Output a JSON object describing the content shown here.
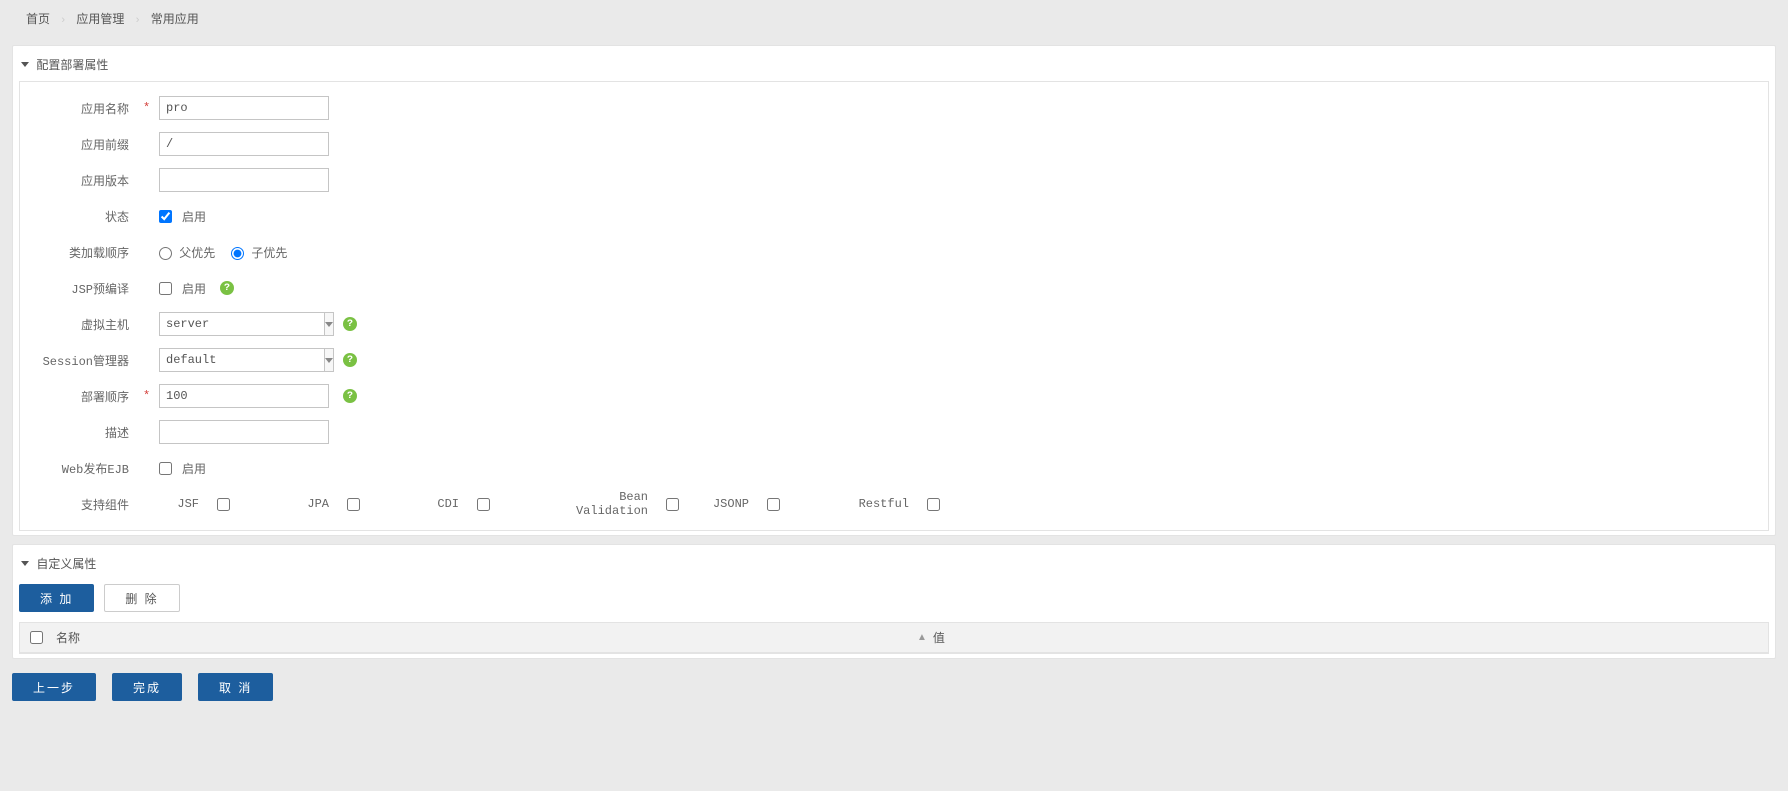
{
  "breadcrumb": {
    "home": "首页",
    "mgmt": "应用管理",
    "current": "常用应用"
  },
  "panel1": {
    "title": "配置部署属性",
    "labels": {
      "appName": "应用名称",
      "appPrefix": "应用前缀",
      "appVersion": "应用版本",
      "status": "状态",
      "classLoad": "类加载顺序",
      "jspPre": "JSP预编译",
      "virtualHost": "虚拟主机",
      "sessionMgr": "Session管理器",
      "deployOrder": "部署顺序",
      "desc": "描述",
      "webEjb": "Web发布EJB",
      "components": "支持组件"
    },
    "values": {
      "appName": "pro",
      "appPrefix": "/",
      "appVersion": "",
      "enable": "启用",
      "parentFirst": "父优先",
      "childFirst": "子优先",
      "virtualHost": "server",
      "sessionMgr": "default",
      "deployOrder": "100",
      "desc": ""
    },
    "components": {
      "jsf": "JSF",
      "jpa": "JPA",
      "cdi": "CDI",
      "beanval": "Bean Validation",
      "jsonp": "JSONP",
      "restful": "Restful"
    }
  },
  "panel2": {
    "title": "自定义属性",
    "buttons": {
      "add": "添 加",
      "del": "删 除"
    },
    "columns": {
      "name": "名称",
      "value": "值"
    }
  },
  "footer": {
    "prev": "上一步",
    "finish": "完成",
    "cancel": "取 消"
  },
  "helpMark": "?"
}
